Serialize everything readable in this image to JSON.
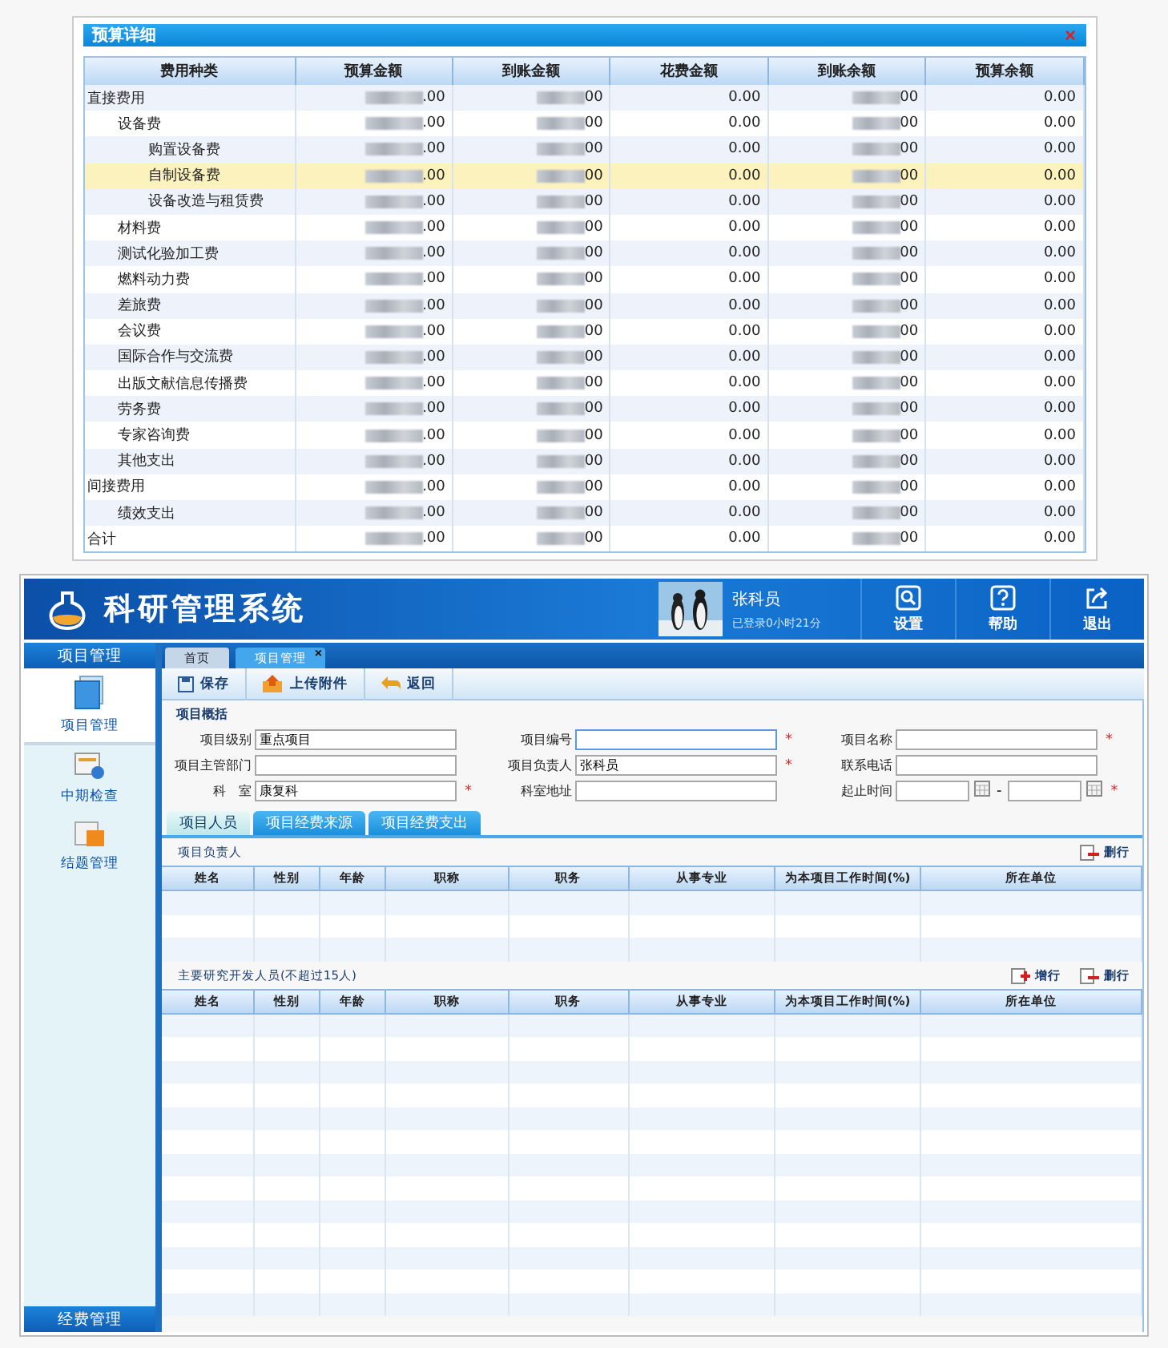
{
  "budget_dialog": {
    "title": "预算详细",
    "close": "×",
    "columns": [
      {
        "label": "费用种类"
      },
      {
        "label": "预算金额",
        "redacted": true
      },
      {
        "label": "到账金额",
        "redacted": true
      },
      {
        "label": "花费金额",
        "redacted": false
      },
      {
        "label": "到账余额",
        "redacted": true
      },
      {
        "label": "预算余额",
        "redacted": false
      }
    ],
    "rows": [
      {
        "name": "直接费用",
        "cells": [
          ".00",
          "00",
          "0.00",
          "00",
          "0.00"
        ],
        "selected": false,
        "children": [
          {
            "name": "设备费",
            "cells": [
              ".00",
              "00",
              "0.00",
              "00",
              "0.00"
            ],
            "selected": false,
            "children": [
              {
                "name": "购置设备费",
                "cells": [
                  ".00",
                  "00",
                  "0.00",
                  "00",
                  "0.00"
                ],
                "selected": false
              },
              {
                "name": "自制设备费",
                "cells": [
                  ".00",
                  "00",
                  "0.00",
                  "00",
                  "0.00"
                ],
                "selected": true
              },
              {
                "name": "设备改造与租赁费",
                "cells": [
                  ".00",
                  "00",
                  "0.00",
                  "00",
                  "0.00"
                ],
                "selected": false
              }
            ]
          },
          {
            "name": "材料费",
            "cells": [
              ".00",
              "00",
              "0.00",
              "00",
              "0.00"
            ],
            "selected": false
          },
          {
            "name": "测试化验加工费",
            "cells": [
              ".00",
              "00",
              "0.00",
              "00",
              "0.00"
            ],
            "selected": false
          },
          {
            "name": "燃料动力费",
            "cells": [
              ".00",
              "00",
              "0.00",
              "00",
              "0.00"
            ],
            "selected": false
          },
          {
            "name": "差旅费",
            "cells": [
              ".00",
              "00",
              "0.00",
              "00",
              "0.00"
            ],
            "selected": false
          },
          {
            "name": "会议费",
            "cells": [
              ".00",
              "00",
              "0.00",
              "00",
              "0.00"
            ],
            "selected": false
          },
          {
            "name": "国际合作与交流费",
            "cells": [
              ".00",
              "00",
              "0.00",
              "00",
              "0.00"
            ],
            "selected": false
          },
          {
            "name": "出版文献信息传播费",
            "cells": [
              ".00",
              "00",
              "0.00",
              "00",
              "0.00"
            ],
            "selected": false
          },
          {
            "name": "劳务费",
            "cells": [
              ".00",
              "00",
              "0.00",
              "00",
              "0.00"
            ],
            "selected": false
          },
          {
            "name": "专家咨询费",
            "cells": [
              ".00",
              "00",
              "0.00",
              "00",
              "0.00"
            ],
            "selected": false
          },
          {
            "name": "其他支出",
            "cells": [
              ".00",
              "00",
              "0.00",
              "00",
              "0.00"
            ],
            "selected": false
          }
        ]
      },
      {
        "name": "间接费用",
        "cells": [
          ".00",
          "00",
          "0.00",
          "00",
          "0.00"
        ],
        "selected": false,
        "children": [
          {
            "name": "绩效支出",
            "cells": [
              ".00",
              "00",
              "0.00",
              "00",
              "0.00"
            ],
            "selected": false
          }
        ]
      },
      {
        "name": "合计",
        "cells": [
          ".00",
          "00",
          "0.00",
          "00",
          "0.00"
        ],
        "selected": false
      }
    ]
  },
  "app": {
    "title": "科研管理系统",
    "user": {
      "name": "张科员",
      "login_time": "已登录0小时21分"
    },
    "header_buttons": [
      {
        "kind": "settings",
        "label": "设置"
      },
      {
        "kind": "help",
        "label": "帮助"
      },
      {
        "kind": "exit",
        "label": "退出"
      }
    ],
    "sidebar": {
      "title": "项目管理",
      "items": [
        {
          "kind": "project",
          "label": "项目管理",
          "selected": true
        },
        {
          "kind": "check",
          "label": "中期检查",
          "selected": false
        },
        {
          "kind": "close",
          "label": "结题管理",
          "selected": false
        }
      ],
      "footer": "经费管理"
    },
    "page_tabs": [
      {
        "label": "首页",
        "selected": false,
        "closable": false
      },
      {
        "label": "项目管理",
        "selected": true,
        "closable": true
      }
    ],
    "close_mark": "×",
    "toolbar": [
      {
        "kind": "save",
        "label": "保存"
      },
      {
        "kind": "upload",
        "label": "上传附件"
      },
      {
        "kind": "back",
        "label": "返回"
      }
    ],
    "section_title": "项目概括",
    "form_rows": [
      [
        {
          "label": "项目级别",
          "value": "重点项目",
          "required": false
        },
        {
          "label": "项目编号",
          "required": true,
          "focused": true
        },
        {
          "label": "项目名称",
          "required": true
        }
      ],
      [
        {
          "label": "项目主管部门",
          "required": false
        },
        {
          "label": "项目负责人",
          "value": "张科员",
          "required": true
        },
        {
          "label": "联系电话",
          "required": false
        }
      ],
      [
        {
          "label": "科　室",
          "value": "康复科",
          "required": true
        },
        {
          "label": "科室地址",
          "required": false
        },
        {
          "label": "起止时间",
          "kind": "date_range",
          "separator": "-",
          "required": true
        }
      ]
    ],
    "required_mark": "*",
    "sub_tabs": [
      {
        "label": "项目人员",
        "selected": true
      },
      {
        "label": "项目经费来源",
        "selected": false
      },
      {
        "label": "项目经费支出",
        "selected": false
      }
    ],
    "person_sections": [
      {
        "title": "项目负责人",
        "actions": [
          {
            "kind": "delete",
            "label": "删行"
          }
        ],
        "columns": [
          "姓名",
          "性别",
          "年龄",
          "职称",
          "职务",
          "从事专业",
          "为本项目工作时间(%)",
          "所在单位"
        ]
      },
      {
        "title": "主要研究开发人员(不超过15人)",
        "actions": [
          {
            "kind": "add",
            "label": "增行"
          },
          {
            "kind": "delete",
            "label": "删行"
          }
        ],
        "columns": [
          "姓名",
          "性别",
          "年龄",
          "职称",
          "职务",
          "从事专业",
          "为本项目工作时间(%)",
          "所在单位"
        ]
      }
    ]
  }
}
